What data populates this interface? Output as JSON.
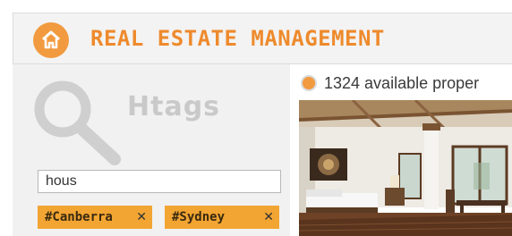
{
  "header": {
    "title": "REAL ESTATE MANAGEMENT",
    "home_icon": "home-icon",
    "accent_color": "#ee8a2c"
  },
  "search": {
    "brand_text": "Htags",
    "brand_icon": "search-icon",
    "input_value": "hous",
    "tags": [
      {
        "label": "#Canberra",
        "remove_label": "✕"
      },
      {
        "label": "#Sydney",
        "remove_label": "✕"
      }
    ],
    "tag_color": "#f2a532"
  },
  "results": {
    "status_text": "1324 available proper",
    "status_icon": "radio-dot-icon",
    "photo": "property-interior-photo"
  }
}
